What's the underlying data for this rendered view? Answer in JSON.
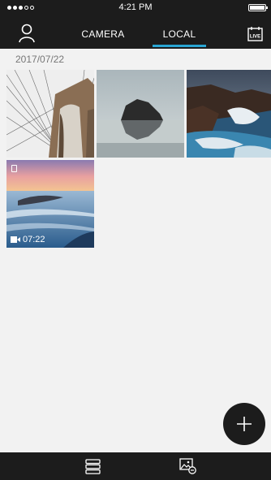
{
  "status_bar": {
    "time": "4:21 PM"
  },
  "nav": {
    "tabs": [
      {
        "label": "CAMERA",
        "active": false
      },
      {
        "label": "LOCAL",
        "active": true
      }
    ],
    "live_label": "LIVE",
    "accent_color": "#2aa6d4"
  },
  "gallery": {
    "date": "2017/07/22",
    "items": [
      {
        "type": "photo",
        "icon": "bridge-photo"
      },
      {
        "type": "photo",
        "icon": "rock-lake-photo"
      },
      {
        "type": "photo",
        "icon": "coastal-rocks-photo"
      },
      {
        "type": "video",
        "icon": "beach-sunset-video",
        "duration": "07:22"
      }
    ]
  },
  "actions": {
    "fab_icon": "plus-icon"
  },
  "bottom_bar": {
    "left_icon": "list-icon",
    "right_icon": "gallery-settings-icon"
  }
}
